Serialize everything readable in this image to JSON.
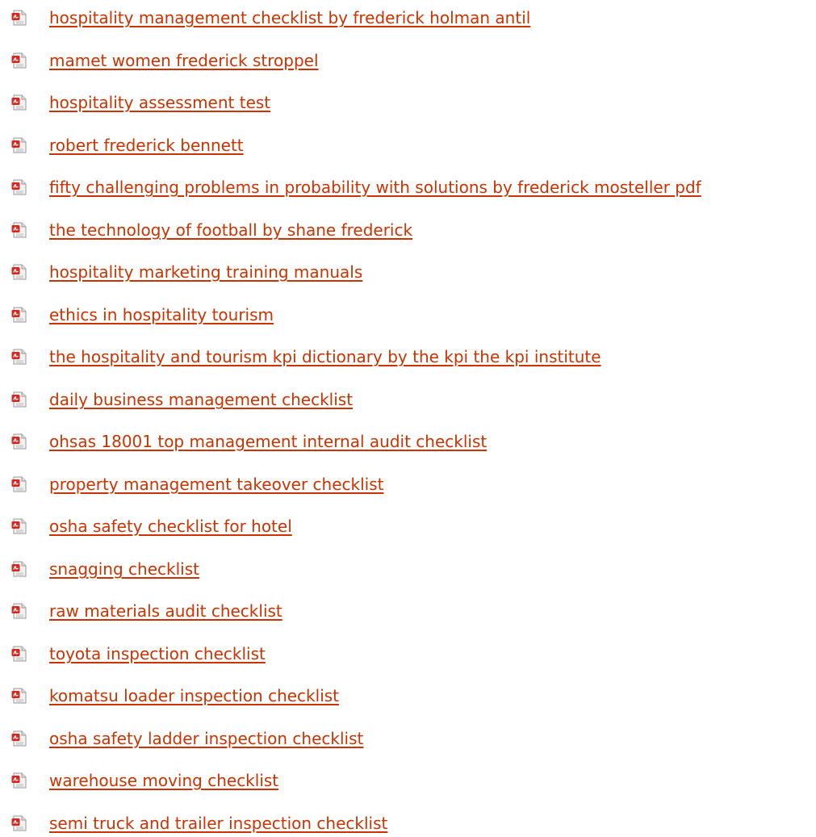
{
  "link_color": "#cc3300",
  "icon": "pdf-file-icon",
  "documents": [
    {
      "label": "hospitality management checklist by frederick holman antil"
    },
    {
      "label": "mamet women frederick stroppel"
    },
    {
      "label": "hospitality assessment test"
    },
    {
      "label": "robert frederick bennett"
    },
    {
      "label": "fifty challenging problems in probability with solutions by frederick mosteller pdf"
    },
    {
      "label": "the technology of football by shane frederick"
    },
    {
      "label": "hospitality marketing training manuals"
    },
    {
      "label": "ethics in hospitality tourism"
    },
    {
      "label": "the hospitality and tourism kpi dictionary by the kpi the kpi institute"
    },
    {
      "label": "daily business management checklist"
    },
    {
      "label": "ohsas 18001 top management internal audit checklist"
    },
    {
      "label": "property management takeover checklist"
    },
    {
      "label": "osha safety checklist for hotel"
    },
    {
      "label": "snagging checklist"
    },
    {
      "label": "raw materials audit checklist"
    },
    {
      "label": "toyota inspection checklist"
    },
    {
      "label": "komatsu loader inspection checklist"
    },
    {
      "label": "osha safety ladder inspection checklist"
    },
    {
      "label": "warehouse moving checklist"
    },
    {
      "label": "semi truck and trailer inspection checklist"
    }
  ]
}
